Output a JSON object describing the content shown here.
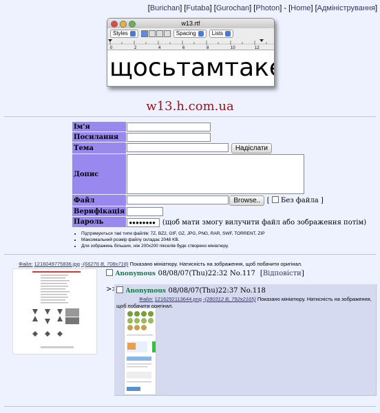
{
  "topnav": {
    "open": "[",
    "close": "]",
    "sep": " - [",
    "links": [
      "Burichan",
      "Futaba",
      "Gurochan",
      "Photon"
    ],
    "home": "Home",
    "admin": "Адміністрування"
  },
  "logo": {
    "window_title": "w13.rtf",
    "styles": "Styles",
    "spacing": "Spacing",
    "lists": "Lists",
    "ruler_numbers": [
      "0",
      "2",
      "4",
      "6",
      "8",
      "10",
      "12"
    ],
    "text": "щосьтамтаке"
  },
  "site_name": "w13.h.com.ua",
  "form": {
    "name_label": "Ім'я",
    "link_label": "Посилання",
    "subject_label": "Тема",
    "submit_label": "Надіслати",
    "comment_label": "Допис",
    "file_label": "Файл",
    "browse_label": "Browse..",
    "nofile_label": "Без файла",
    "verify_label": "Верифікація",
    "password_label": "Пароль",
    "password_value": "●●●●●●●●",
    "password_hint": "(щоб мати змогу вилучити файл або зображення потім)"
  },
  "rules": [
    "Підтримуються такі типи файлів: 7Z, BZ2, GIF, GZ, JPG, PNG, RAR, SWF, TORRENT, ZIP",
    "Максимальний розмір файлу складає 2048 KB.",
    "Для зображень більших, ніж 200x200 пікселів буде створено мініатюру."
  ],
  "op": {
    "file_prefix": "Файл:",
    "file_name": "1216049775836.jpg",
    "file_meta": "-(66276 B, 708x718)",
    "thumb_note": "Показано мініатюру. Натисність на зображення, щоб побачити оригінал.",
    "name": "Anonymous",
    "date": "08/08/07(Thu)22:32",
    "no": "No.117",
    "reply_link": "Відповісти"
  },
  "reply": {
    "arrow": ">>",
    "name": "Anonymous",
    "date": "08/08/07(Thu)22:37",
    "no": "No.118",
    "file_prefix": "Файл:",
    "file_name": "1216292113644.png",
    "file_meta": "-(280312 B, 792x2165)",
    "thumb_note": "Показано мініатюру. Натисність на зображення, щоб побачити оригінал."
  }
}
